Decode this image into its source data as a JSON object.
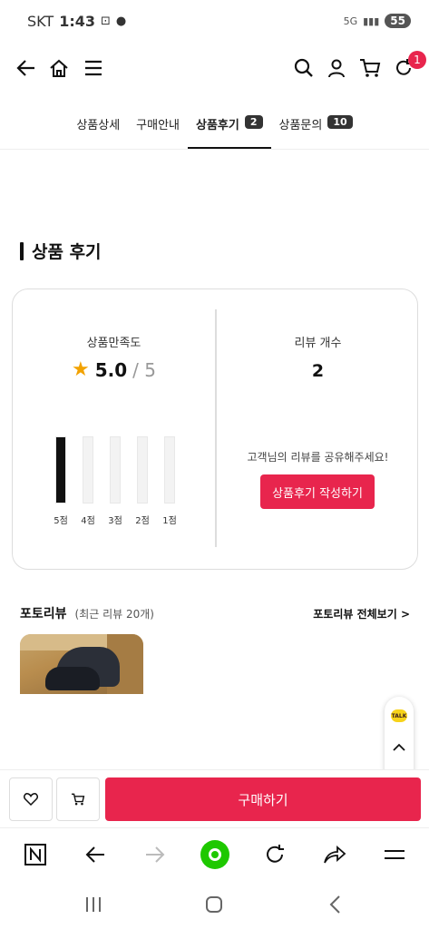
{
  "status_bar": {
    "carrier": "SKT",
    "time": "1:43",
    "network": "5G",
    "battery": "55"
  },
  "top_nav": {
    "cart_badge": "1"
  },
  "tabs": [
    {
      "label": "상품상세",
      "count": ""
    },
    {
      "label": "구매안내",
      "count": ""
    },
    {
      "label": "상품후기",
      "count": "2"
    },
    {
      "label": "상품문의",
      "count": "10"
    }
  ],
  "review_section": {
    "title": "상품 후기",
    "satisfaction_label": "상품만족도",
    "score": "5.0",
    "score_max": "/ 5",
    "count_label": "리뷰 개수",
    "count": "2",
    "share_text": "고객님의 리뷰를 공유해주세요!",
    "write_button": "상품후기 작성하기",
    "rating_bars": [
      {
        "label": "5점",
        "fraction": 1.0
      },
      {
        "label": "4점",
        "fraction": 0
      },
      {
        "label": "3점",
        "fraction": 0
      },
      {
        "label": "2점",
        "fraction": 0
      },
      {
        "label": "1점",
        "fraction": 0
      }
    ]
  },
  "photo_reviews": {
    "title": "포토리뷰",
    "subtitle": "(최근 리뷰 20개)",
    "view_all": "포토리뷰 전체보기 >"
  },
  "floating": {
    "talk_label": "TALK"
  },
  "buy_bar": {
    "buy_label": "구매하기"
  },
  "colors": {
    "accent": "#e8254d",
    "star": "#f2a200",
    "kakao": "#f7d31a",
    "naver_green": "#1ec800"
  }
}
